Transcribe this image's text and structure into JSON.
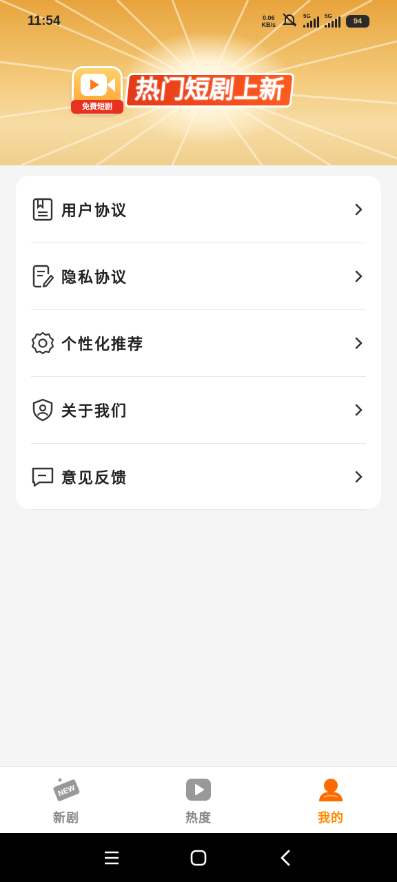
{
  "status_bar": {
    "time": "11:54",
    "net_speed_value": "0.06",
    "net_speed_unit": "KB/s",
    "sim1_gen": "5G",
    "sim2_gen": "5G",
    "battery": "94"
  },
  "banner": {
    "app_badge": "免费短剧",
    "title": "热门短剧上新"
  },
  "menu": {
    "items": [
      {
        "label": "用户协议",
        "icon": "document-icon"
      },
      {
        "label": "隐私协议",
        "icon": "privacy-edit-icon"
      },
      {
        "label": "个性化推荐",
        "icon": "gear-icon"
      },
      {
        "label": "关于我们",
        "icon": "shield-user-icon"
      },
      {
        "label": "意见反馈",
        "icon": "feedback-message-icon"
      }
    ]
  },
  "tabbar": {
    "tabs": [
      {
        "label": "新剧",
        "icon": "new-tag-icon",
        "active": false
      },
      {
        "label": "热度",
        "icon": "play-icon",
        "active": false
      },
      {
        "label": "我的",
        "icon": "user-icon",
        "active": true
      }
    ]
  },
  "colors": {
    "accent": "#ff8a00",
    "inactive_tab": "#888888",
    "background": "#f5f5f5",
    "banner_title_bg": "#e53a17"
  }
}
